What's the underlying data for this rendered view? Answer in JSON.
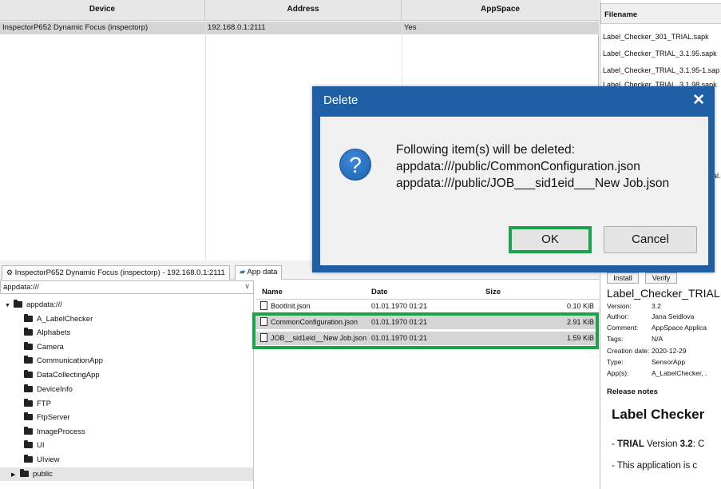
{
  "device_table": {
    "columns": [
      "Device",
      "Address",
      "AppSpace"
    ],
    "rows": [
      {
        "device": "InspectorP652 Dynamic Focus (inspectorp)",
        "address": "192.168.0.1:2111",
        "appspace": "Yes"
      }
    ]
  },
  "file_panel": {
    "header": "Filename",
    "items": [
      "Label_Checker_301_TRIAL.sapk",
      "Label_Checker_TRIAL_3.1.95.sapk",
      "Label_Checker_TRIAL_3.1.95-1.sapk",
      "Label_Checker_TRIAL_3.1.98.sapk"
    ],
    "partial_text": "al.s"
  },
  "tabs": [
    {
      "label": "InspectorP652 Dynamic Focus (inspectorp) - 192.168.0.1:2111",
      "icon": "device-icon"
    },
    {
      "label": "App data",
      "icon": "folder-icon"
    }
  ],
  "path_bar": {
    "value": "appdata:///"
  },
  "tree": {
    "root": "appdata:///",
    "children": [
      "A_LabelChecker",
      "Alphabets",
      "Camera",
      "CommunicationApp",
      "DataCollectingApp",
      "DeviceInfo",
      "FTP",
      "FtpServer",
      "ImageProcess",
      "UI",
      "UIview",
      "public"
    ]
  },
  "file_list": {
    "columns": {
      "name": "Name",
      "date": "Date",
      "size": "Size"
    },
    "rows": [
      {
        "name": "BootInit.json",
        "date": "01.01.1970 01:21",
        "size": "0.10 KiB"
      },
      {
        "name": "CommonConfiguration.json",
        "date": "01.01.1970 01:21",
        "size": "2.91 KiB"
      },
      {
        "name": "JOB__sid1eid__New Job.json",
        "date": "01.01.1970 01:21",
        "size": "1.59 KiB"
      }
    ]
  },
  "info_panel": {
    "install_label": "Install",
    "verify_label": "Verify",
    "app_name": "Label_Checker_TRIAL",
    "fields": [
      {
        "key": "Version:",
        "value": "3.2"
      },
      {
        "key": "Author:",
        "value": "Jana Seidlova"
      },
      {
        "key": "Comment:",
        "value": "AppSpace Applica"
      },
      {
        "key": "Tags:",
        "value": "N/A"
      },
      {
        "key": "Creation date:",
        "value": "2020-12-29"
      },
      {
        "key": "Type:",
        "value": "SensorApp"
      },
      {
        "key": "App(s):",
        "value": "A_LabelChecker, ."
      }
    ],
    "release_notes_label": "Release notes",
    "release_heading": "Label Checker",
    "note1_prefix": "- ",
    "note1_bold": "TRIAL",
    "note1_mid": " Version ",
    "note1_version": "3.2",
    "note1_tail": ": C",
    "note2": "- This application is c"
  },
  "dialog": {
    "title": "Delete",
    "close_glyph": "✕",
    "icon_glyph": "?",
    "message_lines": [
      "Following item(s) will be deleted:",
      "appdata:///public/CommonConfiguration.json",
      "appdata:///public/JOB___sid1eid___New Job.json"
    ],
    "ok_label": "OK",
    "cancel_label": "Cancel"
  },
  "colors": {
    "highlight_green": "#1aa34a",
    "dialog_blue": "#1f5fa6"
  }
}
